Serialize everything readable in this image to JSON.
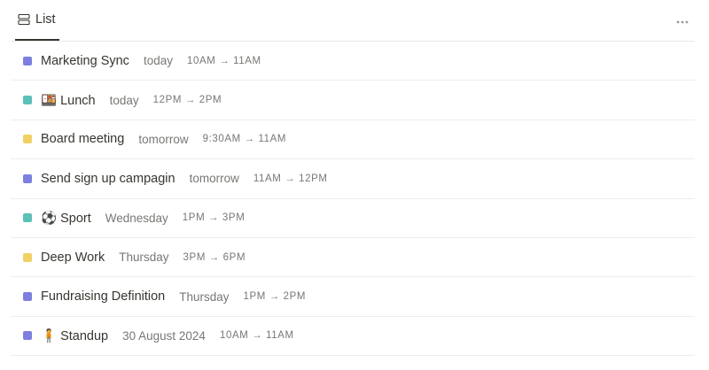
{
  "tab": {
    "label": "List",
    "icon": "list-icon"
  },
  "more_icon": "more-horizontal-icon",
  "colors": {
    "purple": "#7c7fe0",
    "teal": "#5bc0b8",
    "yellow": "#f0d165"
  },
  "items": [
    {
      "title": "Marketing Sync",
      "when": "today",
      "time": "10AM → 11AM",
      "color": "#7c7fe0"
    },
    {
      "title": "🍱 Lunch",
      "when": "today",
      "time": "12PM → 2PM",
      "color": "#5bc0b8"
    },
    {
      "title": "Board meeting",
      "when": "tomorrow",
      "time": "9:30AM → 11AM",
      "color": "#f0d165"
    },
    {
      "title": "Send sign up campagin",
      "when": "tomorrow",
      "time": "11AM → 12PM",
      "color": "#7c7fe0"
    },
    {
      "title": "⚽ Sport",
      "when": "Wednesday",
      "time": "1PM → 3PM",
      "color": "#5bc0b8"
    },
    {
      "title": "Deep Work",
      "when": "Thursday",
      "time": "3PM → 6PM",
      "color": "#f0d165"
    },
    {
      "title": "Fundraising Definition",
      "when": "Thursday",
      "time": "1PM → 2PM",
      "color": "#7c7fe0"
    },
    {
      "title": "🧍 Standup",
      "when": "30 August 2024",
      "time": "10AM → 11AM",
      "color": "#7c7fe0"
    }
  ]
}
